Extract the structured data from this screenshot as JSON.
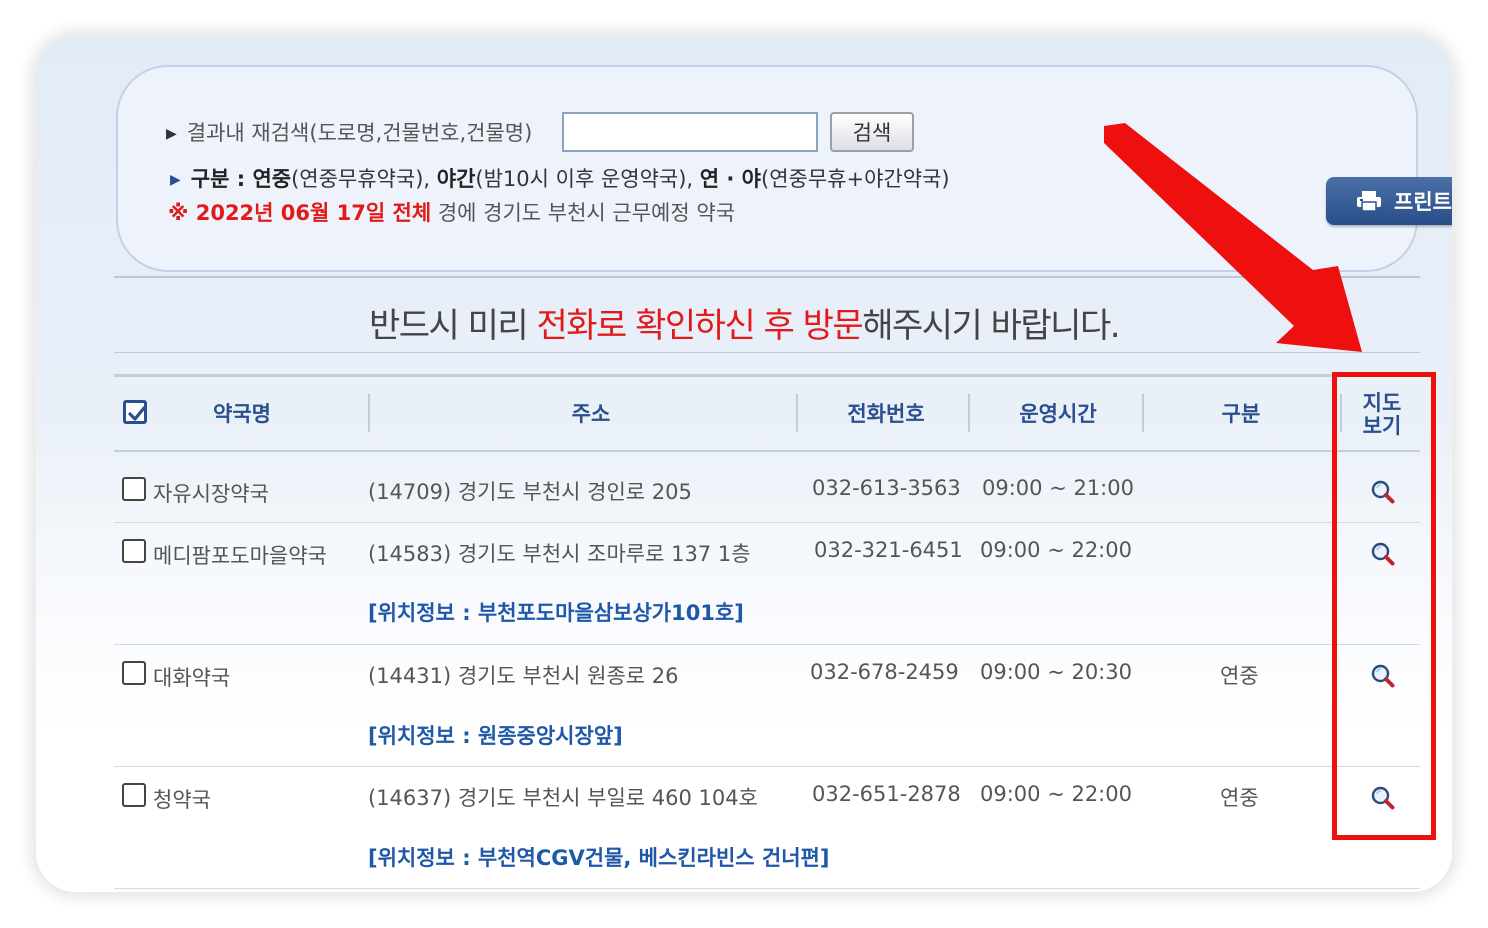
{
  "search": {
    "label": "결과내 재검색(도로명,건물번호,건물명)",
    "input_value": "",
    "button_label": "검색"
  },
  "legend": {
    "prefix": "구분 : ",
    "item1_bold": "연중",
    "item1_text": "(연중무휴약국), ",
    "item2_bold": "야간",
    "item2_text": "(밤10시 이후 운영약국), ",
    "item3_bold": "연 · 야",
    "item3_text": "(연중무휴+야간약국)"
  },
  "date_info": {
    "red_text": "※ 2022년 06월 17일 전체",
    "rest_text": " 경에  경기도  부천시   근무예정 약국"
  },
  "print_button": {
    "label": "프린트",
    "icon": "printer-icon"
  },
  "notice": {
    "part1": "반드시 미리 ",
    "highlight": "전화로 확인하신 후 방문",
    "part2": "해주시기 바랍니다."
  },
  "table": {
    "headers": {
      "name": "약국명",
      "address": "주소",
      "phone": "전화번호",
      "hours": "운영시간",
      "category": "구분",
      "map_line1": "지도",
      "map_line2": "보기"
    },
    "header_checkbox_checked": true,
    "rows": [
      {
        "name": "자유시장약국",
        "address": "(14709) 경기도 부천시 경인로 205",
        "phone": "032-613-3563",
        "hours": "09:00 ~ 21:00",
        "category": "",
        "location": ""
      },
      {
        "name": "메디팜포도마을약국",
        "address": "(14583) 경기도 부천시 조마루로 137 1층",
        "phone": "032-321-6451",
        "hours": "09:00 ~ 22:00",
        "category": "",
        "location": "[위치정보 : 부천포도마을삼보상가101호]"
      },
      {
        "name": "대화약국",
        "address": "(14431) 경기도 부천시 원종로 26",
        "phone": "032-678-2459",
        "hours": "09:00 ~ 20:30",
        "category": "연중",
        "location": "[위치정보 : 원종중앙시장앞]"
      },
      {
        "name": "청약국",
        "address": "(14637) 경기도 부천시 부일로 460 104호",
        "phone": "032-651-2878",
        "hours": "09:00 ~ 22:00",
        "category": "연중",
        "location": "[위치정보 : 부천역CGV건물, 베스킨라빈스 건너편]"
      }
    ]
  },
  "annotation": {
    "highlight_color": "#ee0f0f"
  },
  "colors": {
    "accent_blue": "#2a4f8e",
    "alert_red": "#e21a1a",
    "link_blue": "#1f58a8"
  }
}
